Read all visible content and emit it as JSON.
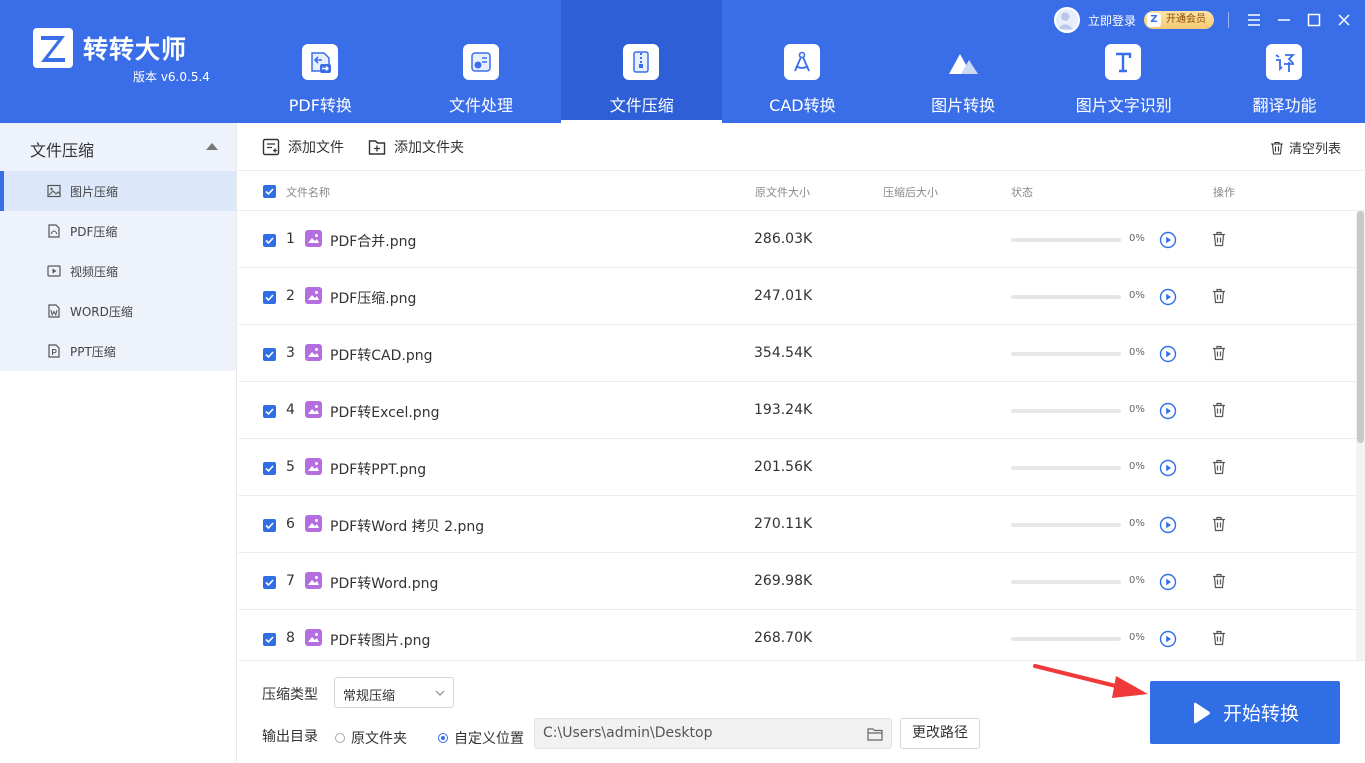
{
  "app": {
    "name": "转转大师",
    "version": "版本 v6.0.5.4"
  },
  "topbar": {
    "login": "立即登录",
    "vip": "开通会员"
  },
  "nav": [
    {
      "label": "PDF转换",
      "icon": "pdf-convert-icon"
    },
    {
      "label": "文件处理",
      "icon": "file-process-icon"
    },
    {
      "label": "文件压缩",
      "icon": "file-compress-icon",
      "active": true
    },
    {
      "label": "CAD转换",
      "icon": "cad-icon"
    },
    {
      "label": "图片转换",
      "icon": "image-convert-icon"
    },
    {
      "label": "图片文字识别",
      "icon": "ocr-icon"
    },
    {
      "label": "翻译功能",
      "icon": "translate-icon"
    }
  ],
  "sidebar": {
    "title": "文件压缩",
    "items": [
      {
        "label": "图片压缩",
        "icon": "image-icon",
        "active": true
      },
      {
        "label": "PDF压缩",
        "icon": "pdf-icon"
      },
      {
        "label": "视频压缩",
        "icon": "video-icon"
      },
      {
        "label": "WORD压缩",
        "icon": "word-icon"
      },
      {
        "label": "PPT压缩",
        "icon": "ppt-icon"
      }
    ]
  },
  "toolbar": {
    "add_file": "添加文件",
    "add_folder": "添加文件夹",
    "clear": "清空列表"
  },
  "table": {
    "headers": {
      "name": "文件名称",
      "orig_size": "原文件大小",
      "comp_size": "压缩后大小",
      "status": "状态",
      "action": "操作"
    },
    "rows": [
      {
        "num": "1",
        "name": "PDF合并.png",
        "size": "286.03K",
        "progress": 0,
        "pct": "0%"
      },
      {
        "num": "2",
        "name": "PDF压缩.png",
        "size": "247.01K",
        "progress": 0,
        "pct": "0%"
      },
      {
        "num": "3",
        "name": "PDF转CAD.png",
        "size": "354.54K",
        "progress": 0,
        "pct": "0%"
      },
      {
        "num": "4",
        "name": "PDF转Excel.png",
        "size": "193.24K",
        "progress": 0,
        "pct": "0%"
      },
      {
        "num": "5",
        "name": "PDF转PPT.png",
        "size": "201.56K",
        "progress": 0,
        "pct": "0%"
      },
      {
        "num": "6",
        "name": "PDF转Word 拷贝 2.png",
        "size": "270.11K",
        "progress": 0,
        "pct": "0%"
      },
      {
        "num": "7",
        "name": "PDF转Word.png",
        "size": "269.98K",
        "progress": 0,
        "pct": "0%"
      },
      {
        "num": "8",
        "name": "PDF转图片.png",
        "size": "268.70K",
        "progress": 0,
        "pct": "0%"
      }
    ]
  },
  "bottom": {
    "compress_type_label": "压缩类型",
    "compress_type_value": "常规压缩",
    "output_label": "输出目录",
    "radio_original": "原文件夹",
    "radio_custom": "自定义位置",
    "path": "C:\\Users\\admin\\Desktop",
    "change_path": "更改路径",
    "start": "开始转换"
  },
  "colors": {
    "accent": "#3a6ee8",
    "header_bg": "#3a6ee8",
    "arrow": "#f03a3a"
  }
}
